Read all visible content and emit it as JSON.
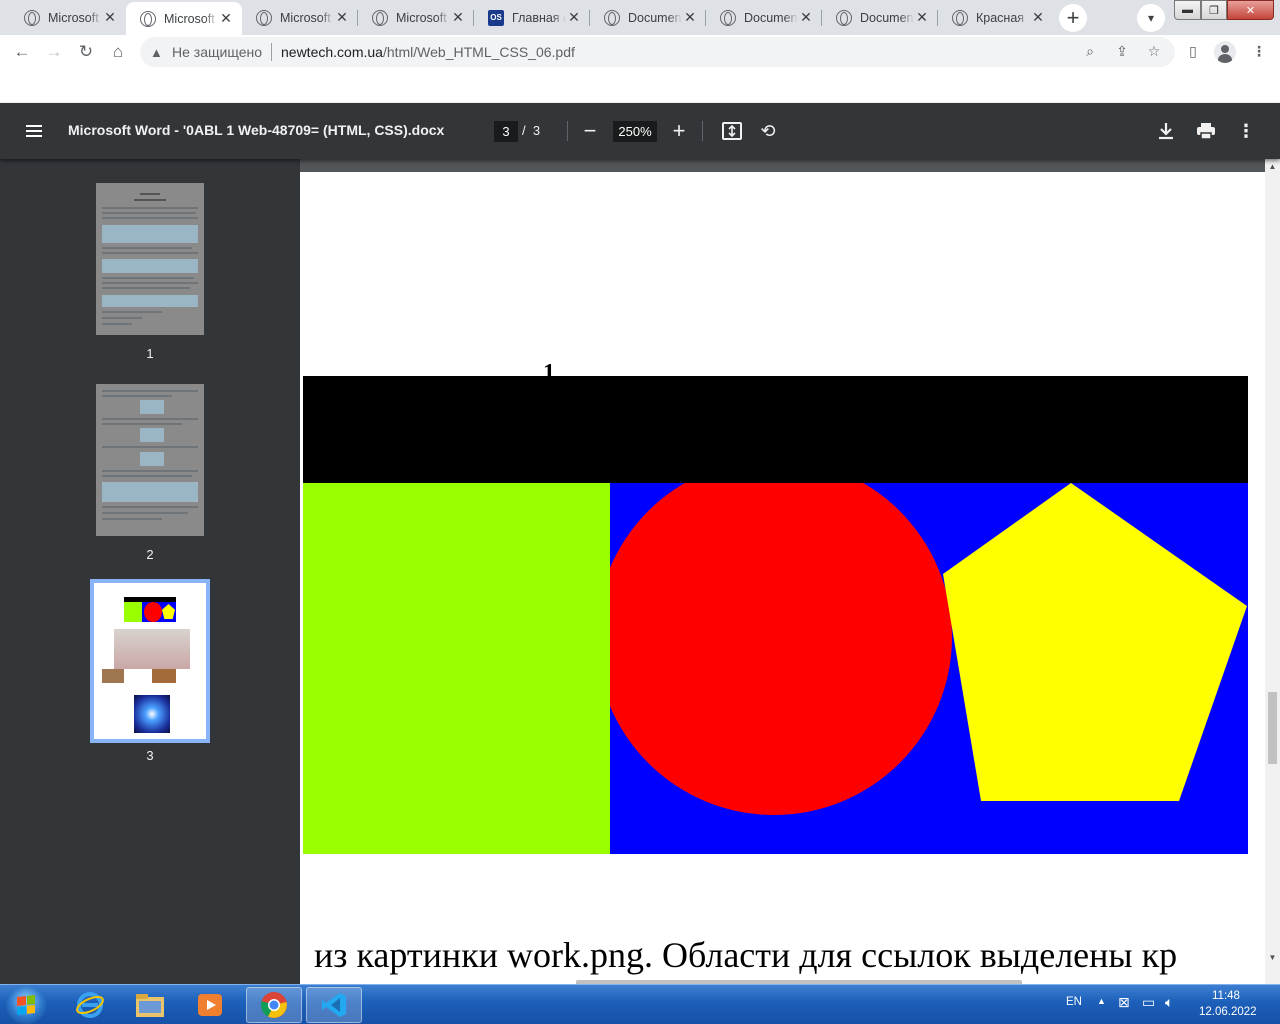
{
  "browser": {
    "tabs": [
      {
        "title": "Microsoft",
        "icon": "globe-icon",
        "active": false
      },
      {
        "title": "Microsoft",
        "icon": "globe-icon",
        "active": true
      },
      {
        "title": "Microsoft",
        "icon": "globe-icon",
        "active": false
      },
      {
        "title": "Microsoft",
        "icon": "globe-icon",
        "active": false
      },
      {
        "title": "Главная с",
        "icon": "site-logo-icon",
        "active": false
      },
      {
        "title": "Documen",
        "icon": "globe-icon",
        "active": false
      },
      {
        "title": "Documen",
        "icon": "globe-icon",
        "active": false
      },
      {
        "title": "Documen",
        "icon": "globe-icon",
        "active": false
      },
      {
        "title": "Красная",
        "icon": "globe-icon",
        "active": false
      }
    ],
    "address": {
      "security_label": "Не защищено",
      "host": "newtech.com.ua",
      "path": "/html/Web_HTML_CSS_06.pdf"
    }
  },
  "pdf": {
    "title": "Microsoft Word - '0ABL 1 Web-48709= (HTML, CSS).docx",
    "current_page": "3",
    "page_separator": "/",
    "total_pages": "3",
    "zoom": "250%",
    "thumbnails": [
      {
        "label": "1"
      },
      {
        "label": "2"
      },
      {
        "label": "3"
      }
    ],
    "page_content": {
      "heading_fragment": "1",
      "bottom_text": "из картинки work.png. Области для ссылок выделены кр",
      "shape_colors": {
        "top_band": "#000000",
        "green_block": "#99ff00",
        "blue_block": "#0000ff",
        "circle": "#ff0000",
        "pentagon": "#ffff00"
      }
    }
  },
  "taskbar": {
    "language": "EN",
    "time": "11:48",
    "date": "12.06.2022"
  }
}
